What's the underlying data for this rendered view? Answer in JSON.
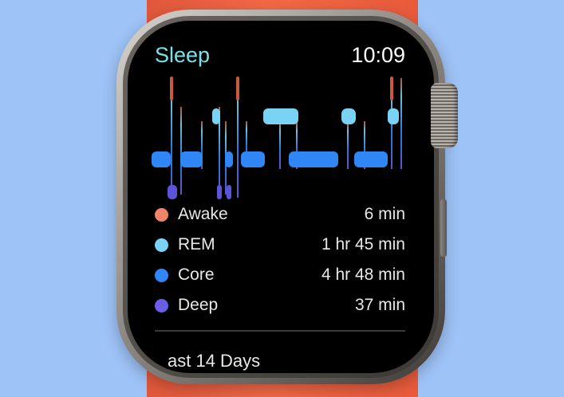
{
  "app": {
    "title": "Sleep",
    "time": "10:09"
  },
  "stages": [
    {
      "label": "Awake",
      "value": "6 min",
      "color": "#f08468"
    },
    {
      "label": "REM",
      "value": "1 hr 45 min",
      "color": "#7ad3f4"
    },
    {
      "label": "Core",
      "value": "4 hr 48 min",
      "color": "#2f86f4"
    },
    {
      "label": "Deep",
      "value": "37 min",
      "color": "#6a5de6"
    }
  ],
  "footer": {
    "text": "ast 14 Days"
  },
  "colors": {
    "background": "#9ec3f7",
    "band": "#f26a47",
    "screen": "#000000",
    "accent_title": "#79e2e8"
  },
  "icons": {
    "legend_dot": "filled-circle"
  }
}
